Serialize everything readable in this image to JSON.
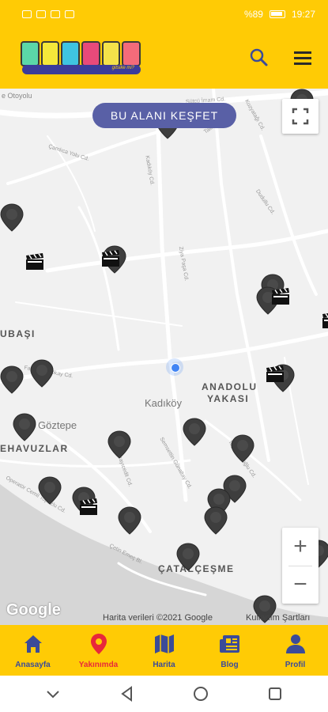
{
  "status_bar": {
    "battery": "%89",
    "time": "19:27"
  },
  "app_bar": {
    "logo_tagline": "gitsike mi?",
    "logo_colors": [
      "#5BD7A8",
      "#F5E83A",
      "#3FC4E0",
      "#E84A7A",
      "#F4E24A",
      "#F36B7A"
    ]
  },
  "map": {
    "explore_button": "BU ALANI KEŞFET",
    "labels": {
      "kadikoy": "Kadıköy",
      "anadolu": "ANADOLU",
      "yakasi": "YAKASI",
      "kubasi": "UBAŞI",
      "goztepe": "Göztepe",
      "ehavuzlar": "EHAVUZLAR",
      "catalcesme": "ÇATALÇEŞME",
      "otoyolu": "e Otoyolu"
    },
    "streets": {
      "s1": "Çamlıca Yolu Cd.",
      "s2": "Sütçü İmam Cd.",
      "s3": "Kadıköy Cd.",
      "s4": "Ziya Paşa Cd.",
      "s5": "Dudullu Cd.",
      "s6": "Fahrettin Gökay Cd.",
      "s7": "Operatör Cemil Topuzlu Cd.",
      "s8": "Sahrayıcedit Cd.",
      "s9": "Çetin Emeç Bl.",
      "s10": "Kozyatağı Cd.",
      "s11": "Talatpaşa Cd.",
      "s12": "Tophanelioğlu Cd.",
      "s13": "Semsettin Günaltay Cd."
    },
    "google_logo": "Google",
    "attribution": "Harita verileri ©2021 Google",
    "terms": "Kullanım Şartları",
    "zoom_in": "+",
    "zoom_out": "−"
  },
  "bottom_nav": {
    "items": [
      {
        "label": "Anasayfa",
        "icon": "home-icon"
      },
      {
        "label": "Yakınımda",
        "icon": "location-pin-icon",
        "active": true
      },
      {
        "label": "Harita",
        "icon": "map-icon"
      },
      {
        "label": "Blog",
        "icon": "newspaper-icon"
      },
      {
        "label": "Profil",
        "icon": "user-icon"
      }
    ]
  },
  "colors": {
    "brand_yellow": "#FFCB05",
    "nav_blue": "#3B4B99",
    "active_red": "#E8283A",
    "explore_purple": "#5960A6"
  }
}
